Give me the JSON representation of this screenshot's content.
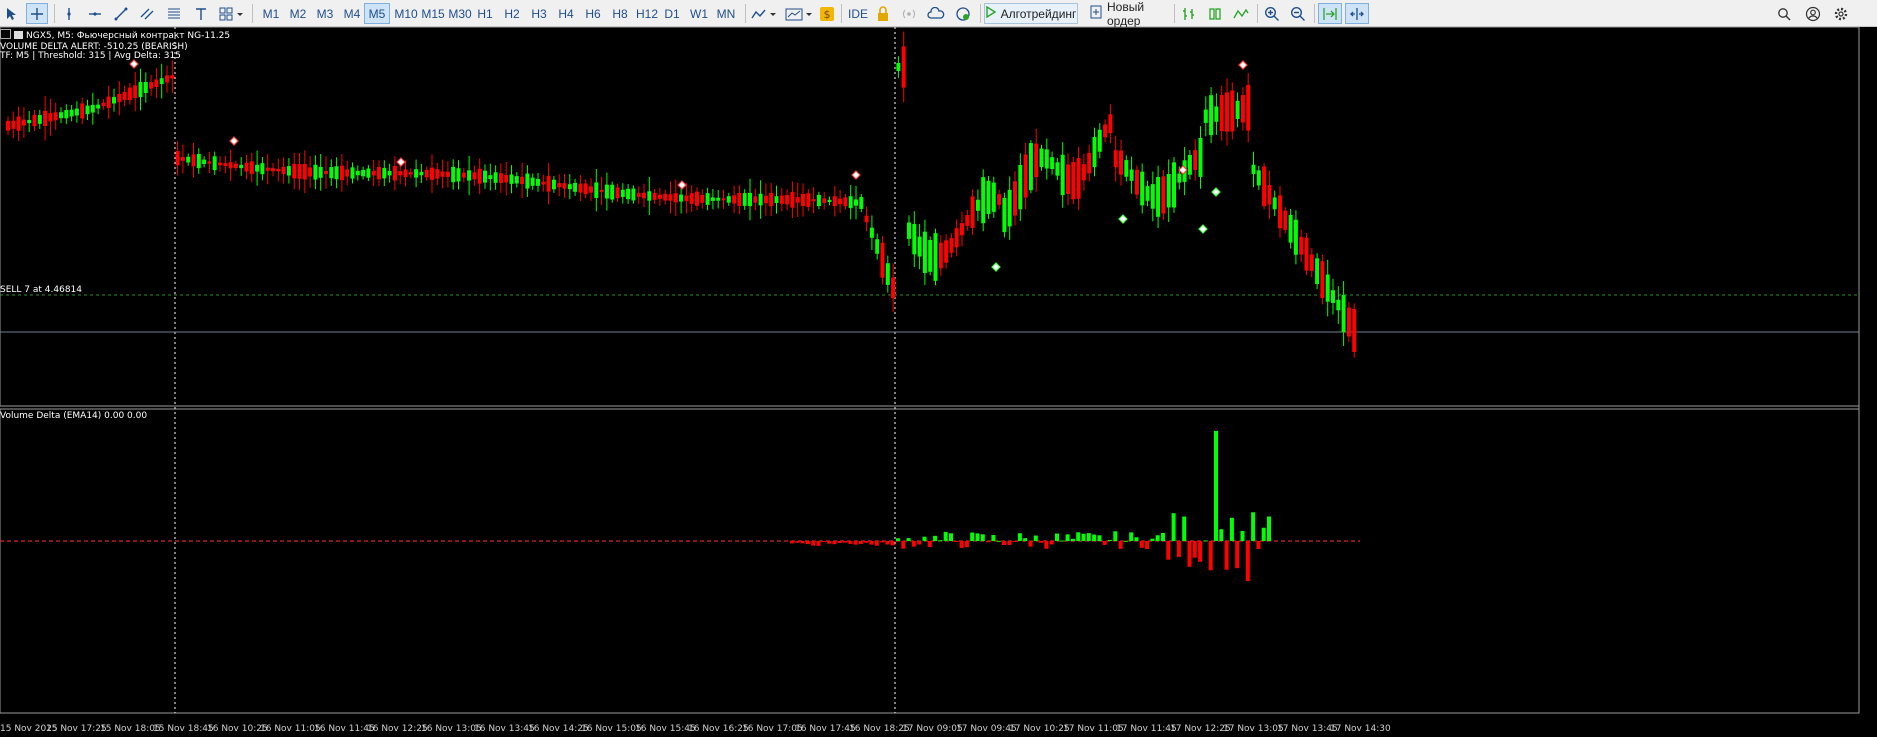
{
  "toolbar": {
    "timeframes": [
      "M1",
      "M2",
      "M3",
      "M4",
      "M5",
      "M10",
      "M15",
      "M30",
      "H1",
      "H2",
      "H3",
      "H4",
      "H6",
      "H8",
      "H12",
      "D1",
      "W1",
      "MN"
    ],
    "active_timeframe": "M5",
    "ide_label": "IDE",
    "algotrading_label": "Алготрейдинг",
    "new_order_label": "Новый ордер"
  },
  "chart": {
    "header": "NGX5, M5:  Фьючерсный контракт NG-11.25",
    "alert_line": "VOLUME DELTA ALERT: -510.25 (BEARISH)",
    "info_line": "TF: M5 | Threshold: 315 | Avg Delta: 315",
    "order_label": "SELL 7 at 4.46814",
    "indicator_label": "Volume Delta (EMA14) 0.00 0.00",
    "time_labels": [
      "15 Nov 2025",
      "15 Nov 17:25",
      "15 Nov 18:05",
      "15 Nov 18:45",
      "16 Nov 10:25",
      "16 Nov 11:05",
      "16 Nov 11:45",
      "16 Nov 12:25",
      "16 Nov 13:05",
      "16 Nov 13:45",
      "16 Nov 14:25",
      "16 Nov 15:05",
      "16 Nov 15:45",
      "16 Nov 16:25",
      "16 Nov 17:05",
      "16 Nov 17:45",
      "16 Nov 18:25",
      "17 Nov 09:05",
      "17 Nov 09:45",
      "17 Nov 10:25",
      "17 Nov 11:05",
      "17 Nov 11:45",
      "17 Nov 12:25",
      "17 Nov 13:05",
      "17 Nov 13:45",
      "17 Nov 14:30"
    ],
    "colors": {
      "bull": "#00ff00",
      "bear": "#ff0000",
      "grid": "#ffffff",
      "hline": "#708090",
      "order": "#2e8b2e"
    }
  }
}
